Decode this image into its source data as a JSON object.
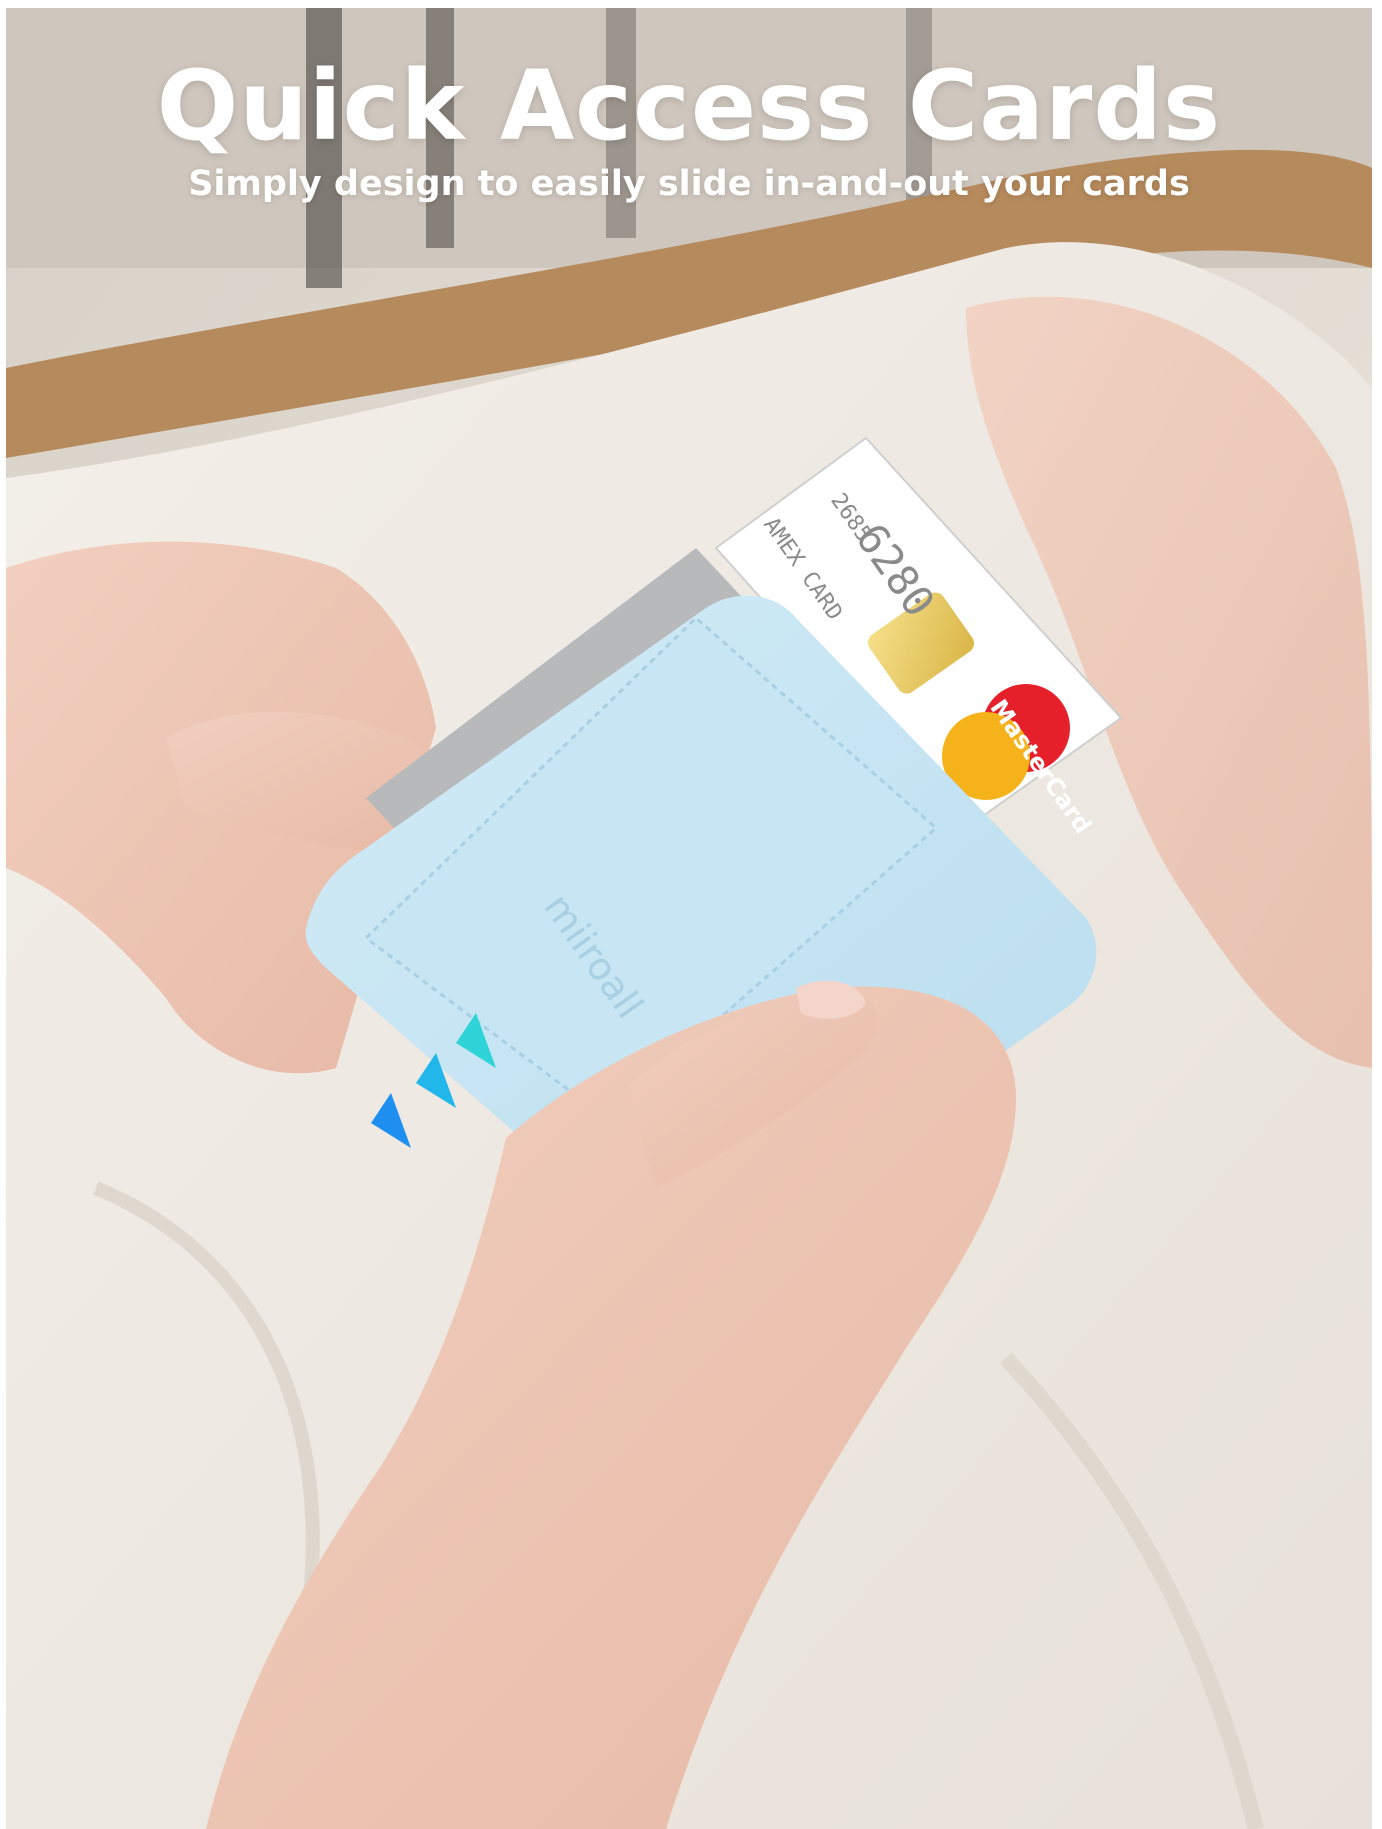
{
  "headline": "Quick Access Cards",
  "subheadline": "Simply design to easily slide in-and-out your cards",
  "card": {
    "issuer": "AMEX CARD",
    "number_part_a": "6280",
    "number_part_b": "2685",
    "network": "MasterCard"
  },
  "wallet": {
    "brand": "miiroall",
    "color": "#c4e2f1",
    "arrow_colors": [
      "#2fd4d8",
      "#22b7ea",
      "#1e8ff0"
    ]
  }
}
